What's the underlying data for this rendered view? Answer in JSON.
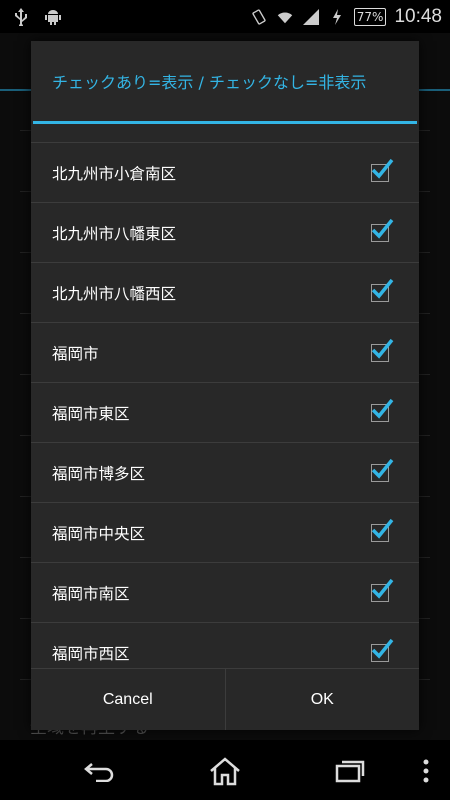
{
  "status_bar": {
    "icons_left": [
      "usb-icon",
      "android-icon"
    ],
    "icons_right": [
      "vibrate-icon",
      "wifi-icon",
      "signal-icon",
      "charging-icon"
    ],
    "battery": "77%",
    "time": "10:48"
  },
  "background": {
    "partial_text": "全域を再生する"
  },
  "dialog": {
    "title": "チェックあり=表示 / チェックなし=非表示",
    "items": [
      {
        "label": "北九州市小倉南区",
        "checked": true
      },
      {
        "label": "北九州市八幡東区",
        "checked": true
      },
      {
        "label": "北九州市八幡西区",
        "checked": true
      },
      {
        "label": "福岡市",
        "checked": true
      },
      {
        "label": "福岡市東区",
        "checked": true
      },
      {
        "label": "福岡市博多区",
        "checked": true
      },
      {
        "label": "福岡市中央区",
        "checked": true
      },
      {
        "label": "福岡市南区",
        "checked": true
      },
      {
        "label": "福岡市西区",
        "checked": true
      }
    ],
    "cancel_label": "Cancel",
    "ok_label": "OK"
  },
  "navbar": {
    "icons": [
      "back-icon",
      "home-icon",
      "recent-apps-icon",
      "menu-icon"
    ]
  },
  "colors": {
    "accent": "#33b5e5",
    "dialog_bg": "#282828"
  }
}
